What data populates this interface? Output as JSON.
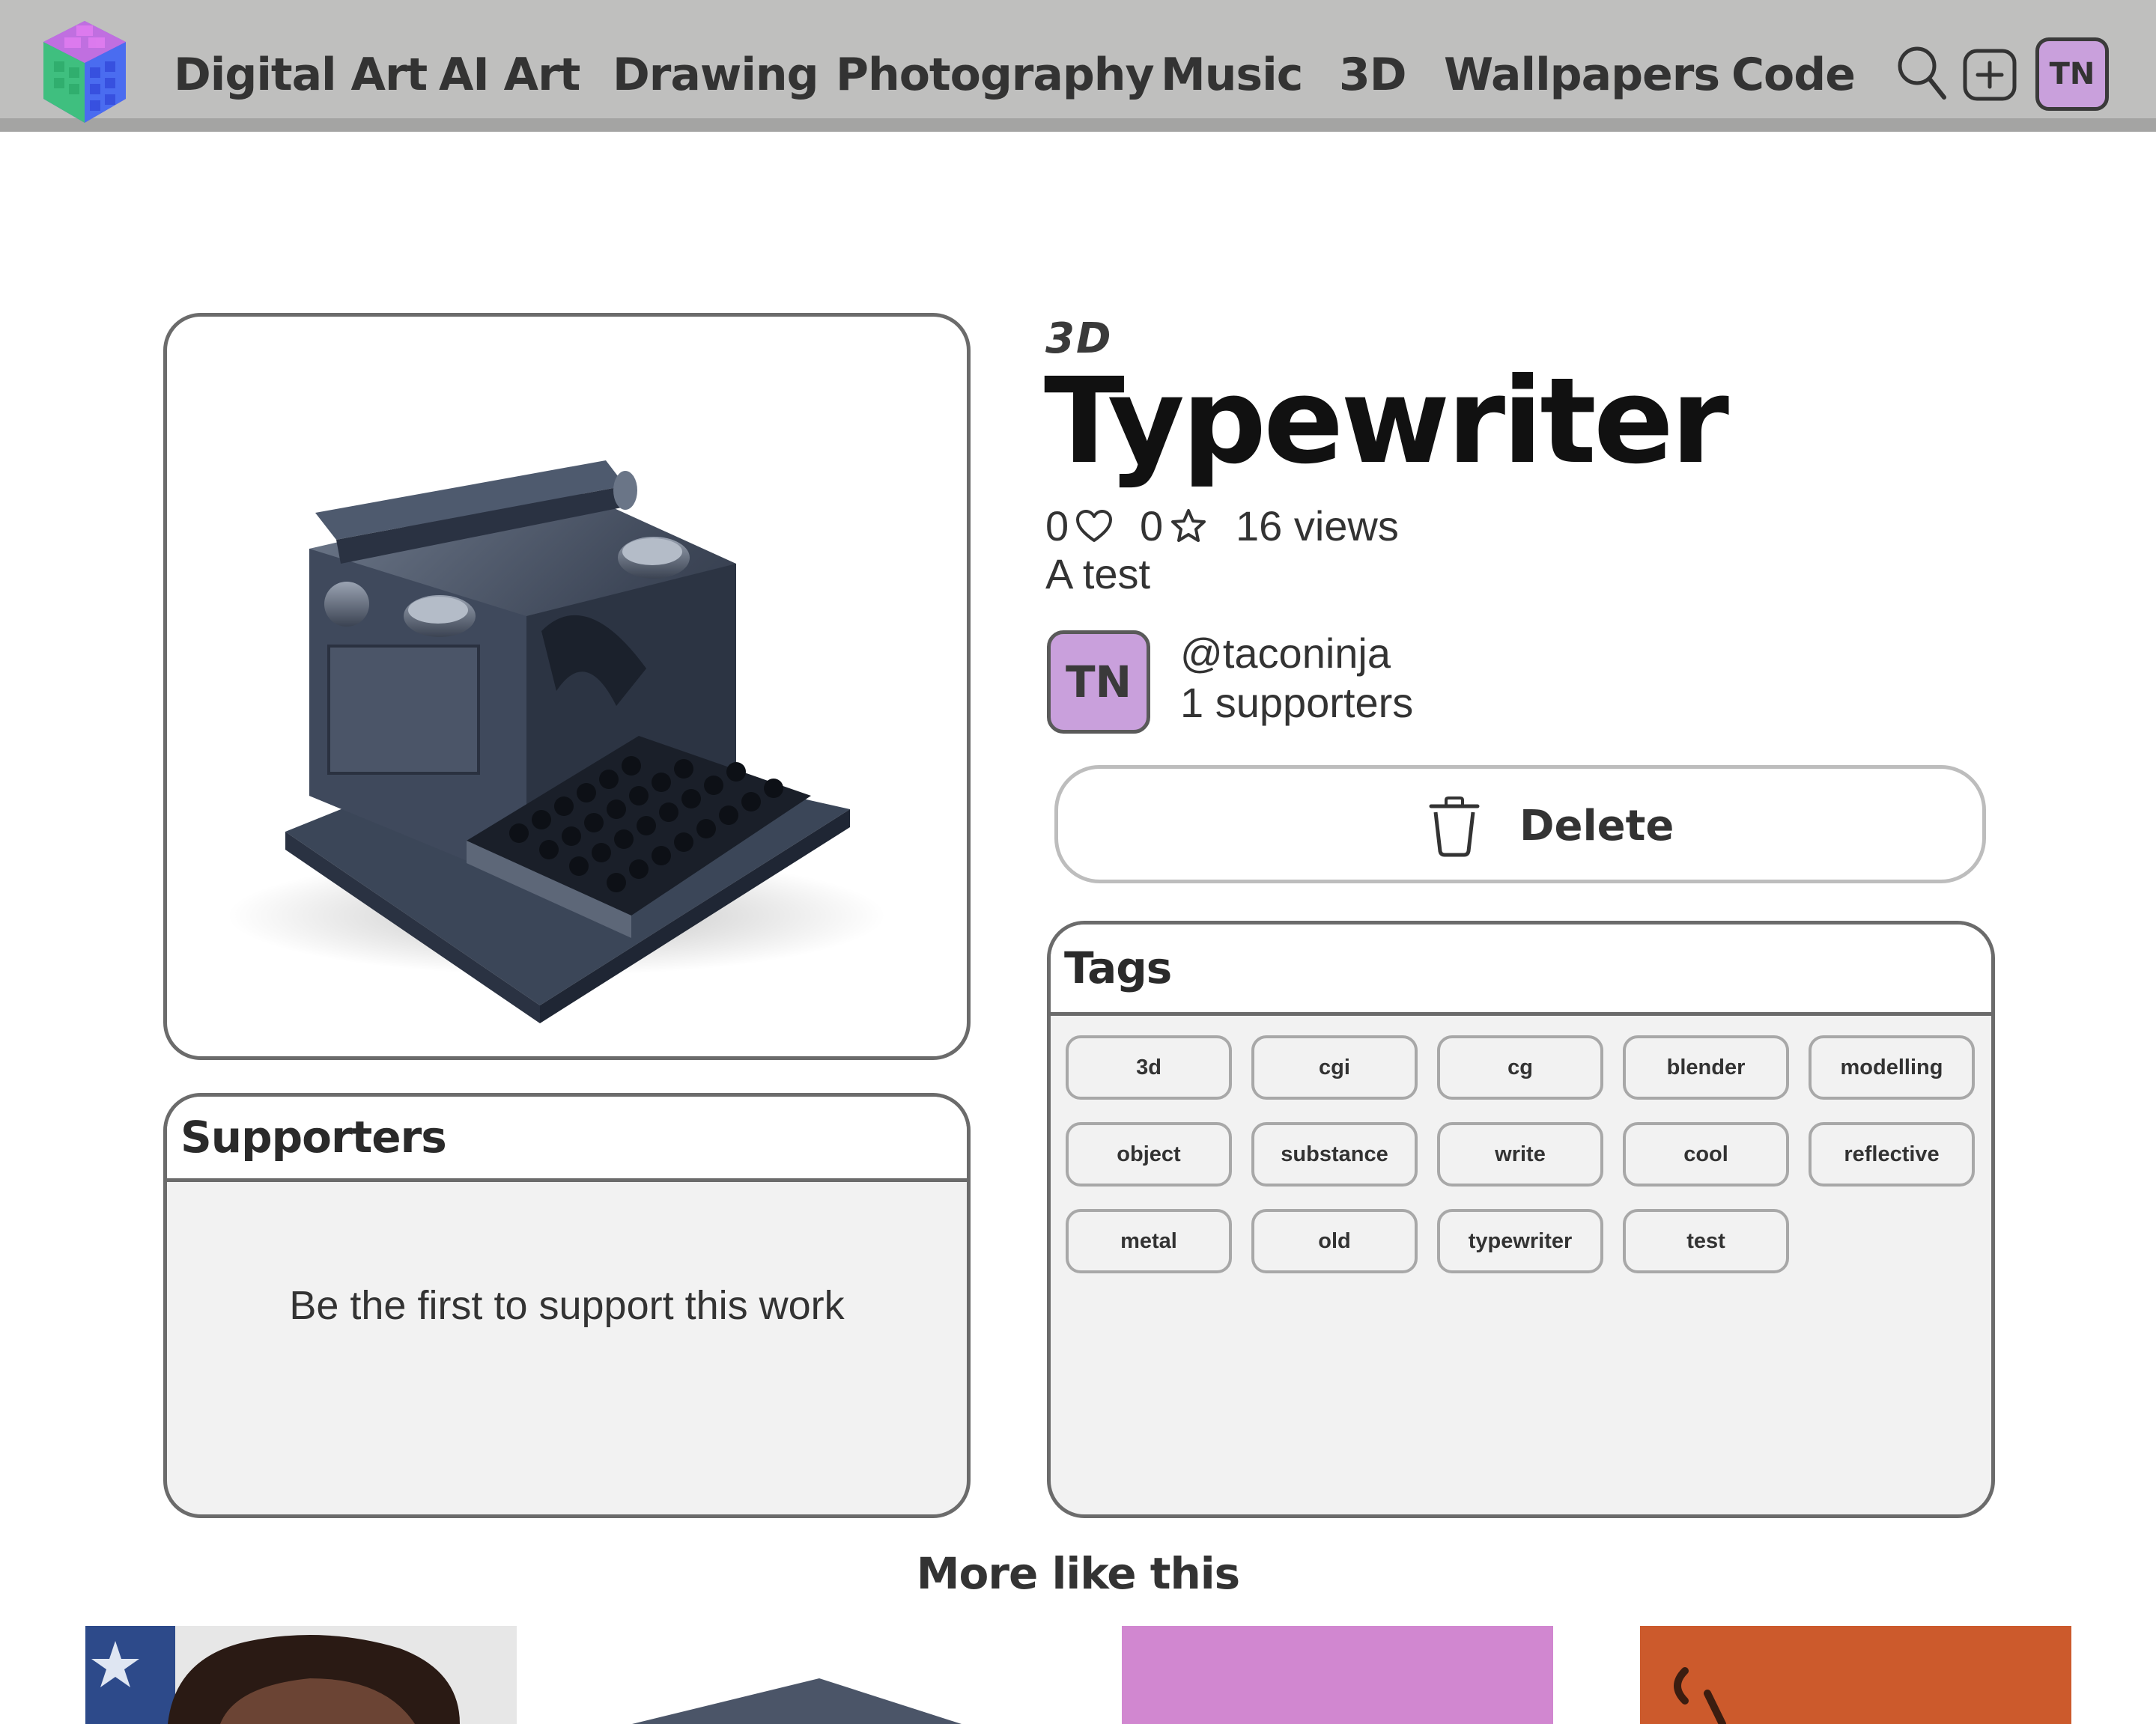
{
  "nav": {
    "items": [
      "Digital Art",
      "AI Art",
      "Drawing",
      "Photography",
      "Music",
      "3D",
      "Wallpapers",
      "Code"
    ],
    "user_initials": "TN"
  },
  "artwork": {
    "category": "3D",
    "title": "Typewriter",
    "likes": "0",
    "favorites": "0",
    "views": "16 views",
    "description": "A test",
    "author": {
      "initials": "TN",
      "handle": "@taconinja",
      "supporters": "1 supporters"
    },
    "delete_label": "Delete"
  },
  "supporters": {
    "title": "Supporters",
    "empty_message": "Be the first to support this work"
  },
  "tags": {
    "title": "Tags",
    "items": [
      "3d",
      "cgi",
      "cg",
      "blender",
      "modelling",
      "object",
      "substance",
      "write",
      "cool",
      "reflective",
      "metal",
      "old",
      "typewriter",
      "test"
    ]
  },
  "more": {
    "title": "More like this"
  },
  "colors": {
    "navbar_bg": "#bfbfbe",
    "avatar_bg": "#c9a0dc",
    "thumb_pink": "#d187d0",
    "thumb_orange": "#cc5a2c"
  },
  "icons": [
    "logo-icon",
    "search-icon",
    "add-icon",
    "heart-icon",
    "star-icon",
    "trash-icon"
  ]
}
